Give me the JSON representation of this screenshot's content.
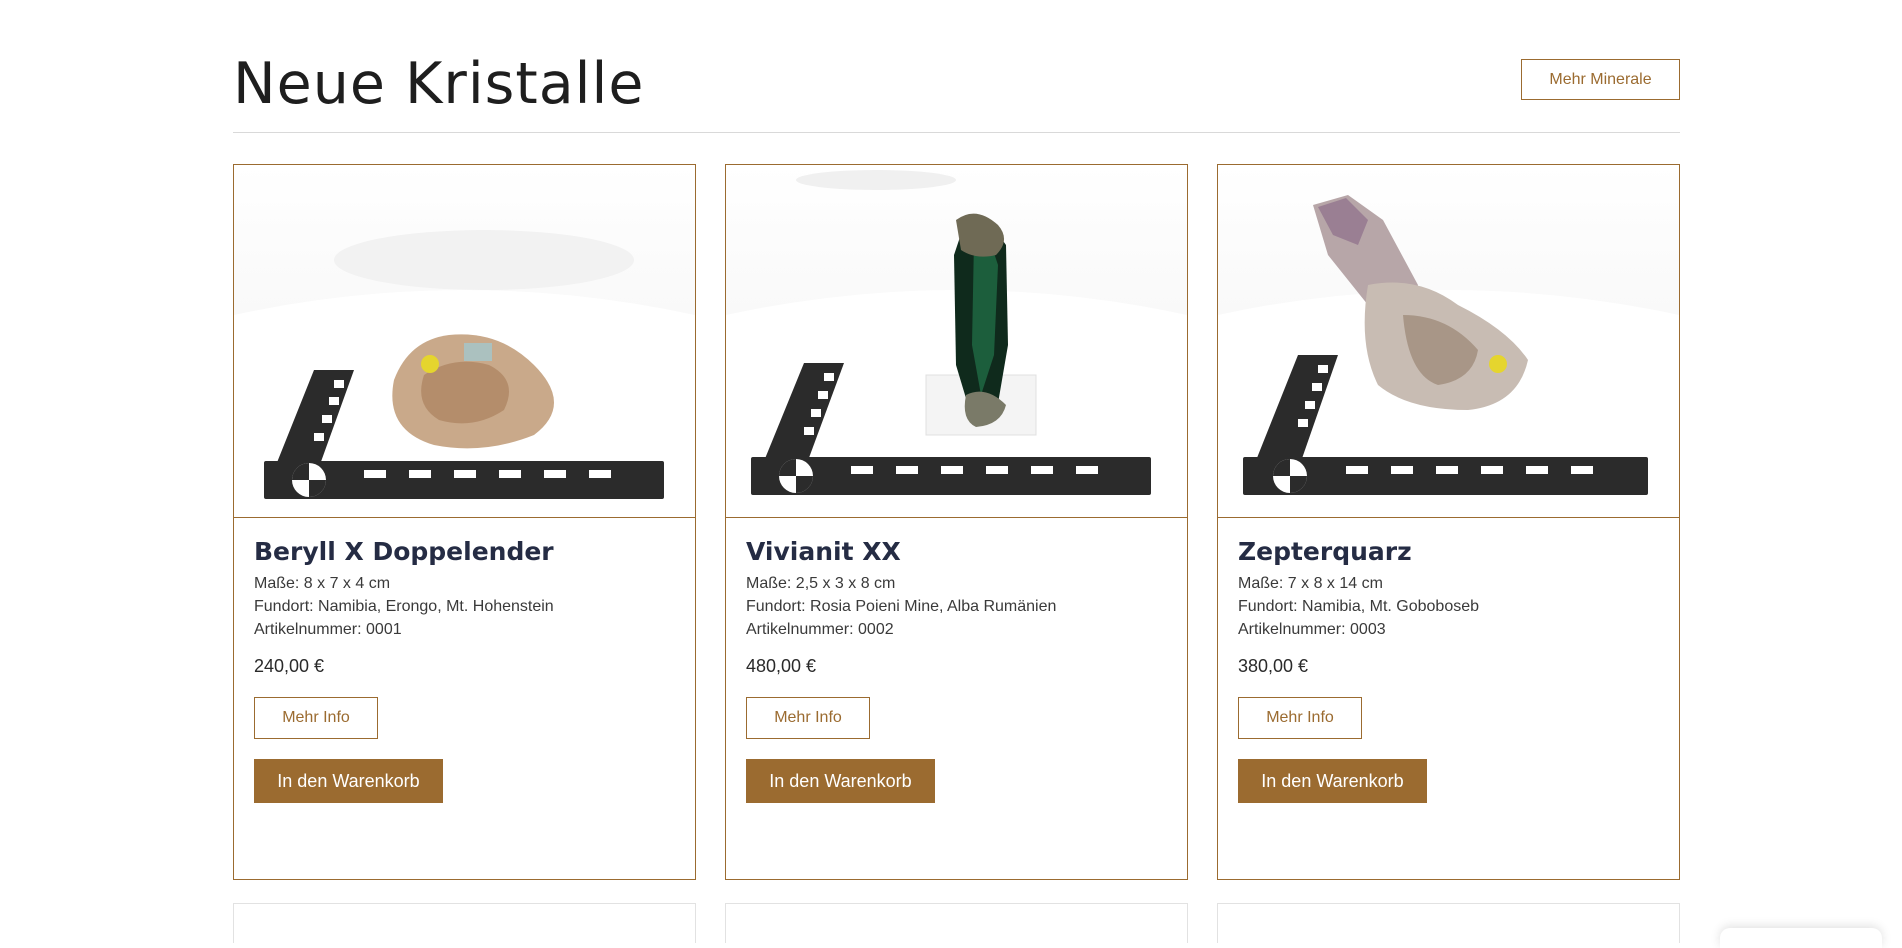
{
  "section": {
    "title": "Neue Kristalle",
    "more_button": "Mehr Minerale"
  },
  "products": [
    {
      "name": "Beryll X Doppelender",
      "dimensions": "Maße: 8 x 7 x 4 cm",
      "location": "Fundort: Namibia, Erongo, Mt. Hohenstein",
      "article": "Artikelnummer: 0001",
      "price": "240,00 €",
      "info_button": "Mehr Info",
      "cart_button": "In den Warenkorb",
      "image_icon": "beryll-specimen-photo"
    },
    {
      "name": "Vivianit XX",
      "dimensions": "Maße: 2,5 x 3 x 8 cm",
      "location": "Fundort: Rosia Poieni Mine, Alba Rumänien",
      "article": "Artikelnummer: 0002",
      "price": "480,00 €",
      "info_button": "Mehr Info",
      "cart_button": "In den Warenkorb",
      "image_icon": "vivianit-specimen-photo"
    },
    {
      "name": "Zepterquarz",
      "dimensions": "Maße: 7 x 8 x 14 cm",
      "location": "Fundort: Namibia, Mt. Goboboseb",
      "article": "Artikelnummer: 0003",
      "price": "380,00 €",
      "info_button": "Mehr Info",
      "cart_button": "In den Warenkorb",
      "image_icon": "zepterquarz-specimen-photo"
    }
  ],
  "colors": {
    "accent": "#9b6b30",
    "title_text": "#252c44",
    "divider": "#d9d9d9"
  }
}
